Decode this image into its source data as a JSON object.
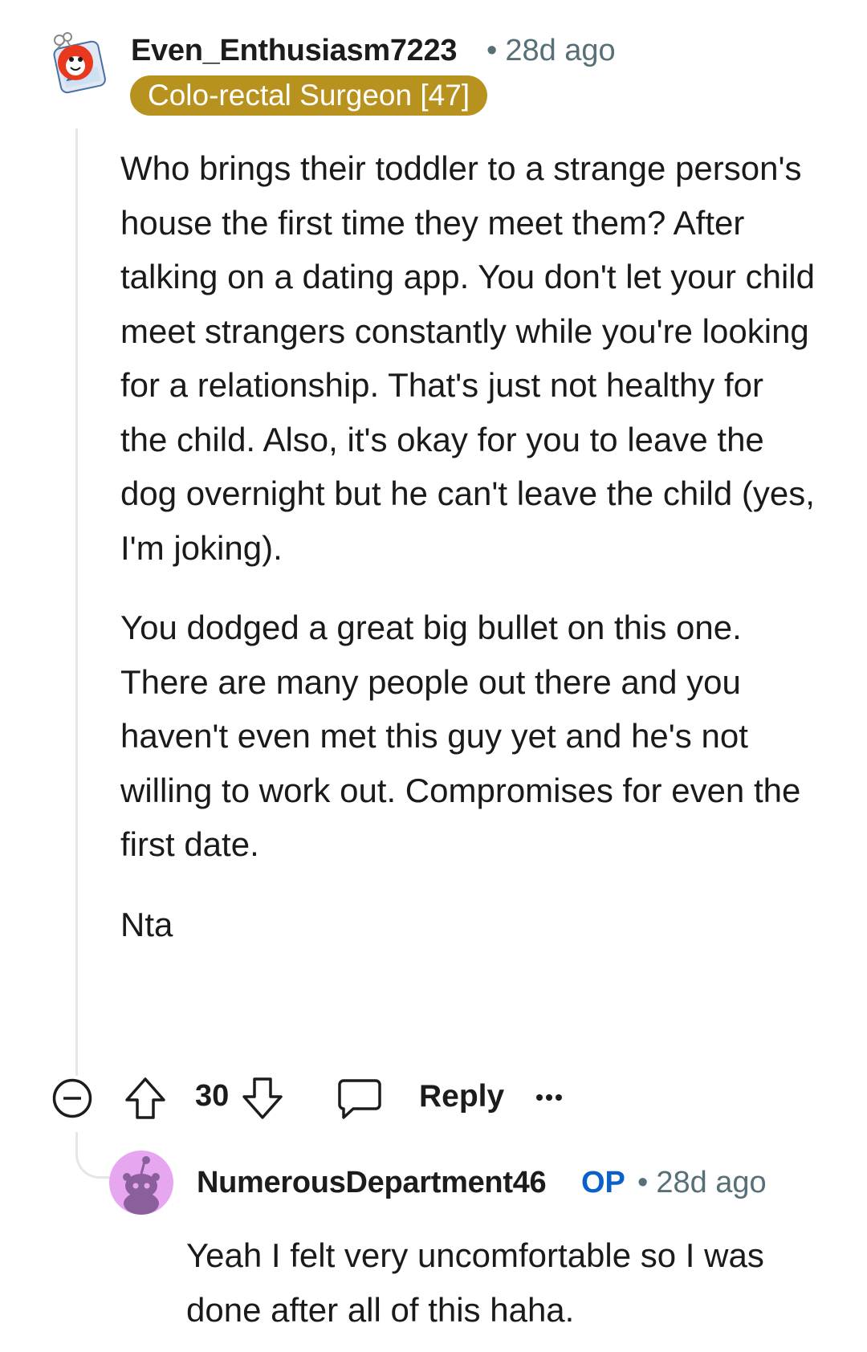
{
  "comment": {
    "author": "Even_Enthusiasm7223",
    "separator": "•",
    "time": "28d ago",
    "flair": "Colo-rectal Surgeon [47]",
    "avatar_icon": "red-monster-snoovatar-icon",
    "body": [
      "Who brings their toddler to a strange person's house the first time they meet them? After talking on a dating app. You don't let your child meet strangers constantly while you're looking for a relationship. That's just not healthy for the child. Also, it's okay for you to leave the dog overnight but he can't leave the child (yes, I'm joking).",
      "You dodged a great big bullet on this one. There are many people out there and you haven't even met this guy yet and he's not willing to work out. Compromises for even the first date.",
      "Nta"
    ],
    "votes": "30",
    "reply_label": "Reply",
    "icons": {
      "collapse": "collapse-minus-icon",
      "upvote": "upvote-arrow-icon",
      "downvote": "downvote-arrow-icon",
      "reply": "speech-bubble-icon",
      "more": "more-options-icon"
    }
  },
  "reply": {
    "author": "NumerousDepartment46",
    "op_badge": "OP",
    "separator": "•",
    "time": "28d ago",
    "avatar_icon": "default-snoo-avatar-icon",
    "avatar_color": "#e6a7f0",
    "body": "Yeah I felt very uncomfortable so I was done after all of this haha."
  },
  "colors": {
    "flair_bg": "#b8921e",
    "op_blue": "#0a62c8",
    "meta_gray": "#576f76"
  }
}
